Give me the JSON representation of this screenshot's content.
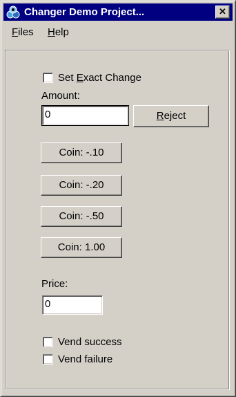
{
  "window": {
    "title": "Changer Demo Project...",
    "close_glyph": "✕"
  },
  "menu": {
    "items": [
      {
        "label": "Files",
        "accel": "F",
        "rest": "iles"
      },
      {
        "label": "Help",
        "accel": "H",
        "rest": "elp"
      }
    ]
  },
  "form": {
    "set_exact_change": {
      "pre": "Set ",
      "accel": "E",
      "post": "xact Change",
      "checked": false
    },
    "amount_label": "Amount:",
    "amount_value": "0",
    "reject_button": {
      "accel": "R",
      "rest": "eject"
    },
    "coins": [
      "Coin: -.10",
      "Coin: -.20",
      "Coin: -.50",
      "Coin: 1.00"
    ],
    "price_label": "Price:",
    "price_value": "0",
    "vend_success": {
      "label": "Vend success",
      "checked": false
    },
    "vend_failure": {
      "label": "Vend failure",
      "checked": false
    }
  },
  "colors": {
    "title_bar": "#000080",
    "face": "#d4d0c8"
  },
  "icons": {
    "app": "app-icon",
    "close": "close-icon"
  }
}
